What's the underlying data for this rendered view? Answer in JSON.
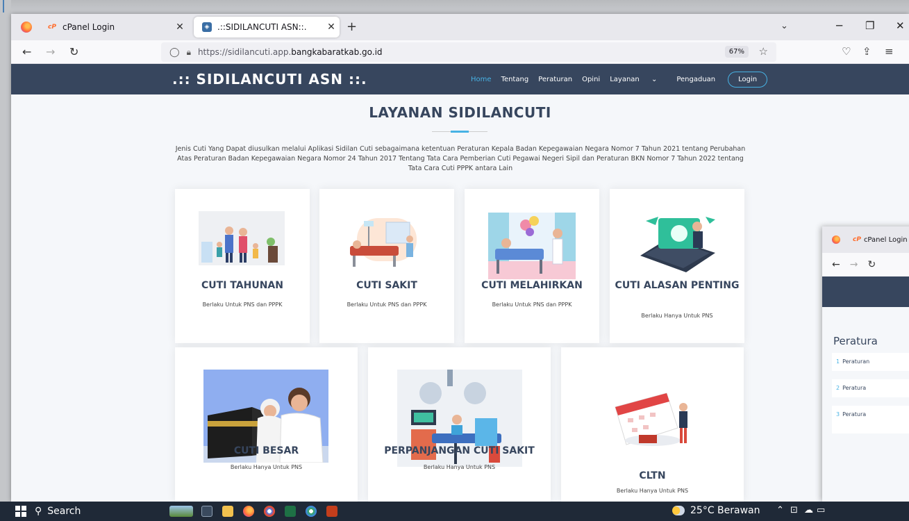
{
  "browser": {
    "tabs": [
      {
        "title": "cPanel Login",
        "favicon": "cpanel-icon"
      },
      {
        "title": ".::SIDILANCUTI ASN::.",
        "favicon": "site-icon",
        "active": true
      }
    ],
    "url_prefix": "https://sidilancuti.app.",
    "url_domain": "bangkabaratkab.go.id",
    "zoom": "67%"
  },
  "site": {
    "brand": ".:: SIDILANCUTI ASN ::.",
    "menu": [
      "Home",
      "Tentang",
      "Peraturan",
      "Opini",
      "Layanan",
      "Pengaduan"
    ],
    "login_label": "Login",
    "section_title": "LAYANAN SIDILANCUTI",
    "intro": "Jenis Cuti Yang Dapat diusulkan melalui Aplikasi Sidilan Cuti sebagaimana ketentuan Peraturan Kepala Badan Kepegawaian Negara Nomor 7 Tahun 2021 tentang Perubahan Atas Peraturan Badan Kepegawaian Negara Nomor 24 Tahun 2017 Tentang Tata Cara Pemberian Cuti Pegawai Negeri Sipil dan Peraturan BKN Nomor 7 Tahun 2022 tentang Tata Cara Cuti PPPK antara Lain",
    "services": [
      {
        "name": "CUTI TAHUNAN",
        "desc": "Berlaku Untuk PNS dan PPPK"
      },
      {
        "name": "CUTI SAKIT",
        "desc": "Berlaku Untuk PNS dan PPPK"
      },
      {
        "name": "CUTI MELAHIRKAN",
        "desc": "Berlaku Untuk PNS dan PPPK"
      },
      {
        "name": "CUTI ALASAN PENTING",
        "desc": "Berlaku Hanya Untuk PNS"
      },
      {
        "name": "CUTI BESAR",
        "desc": "Berlaku Hanya Untuk PNS"
      },
      {
        "name": "PERPANJANGAN CUTI SAKIT",
        "desc": "Berlaku Hanya Untuk PNS"
      },
      {
        "name": "CLTN",
        "desc": "Berlaku Hanya Untuk PNS"
      }
    ]
  },
  "second_window": {
    "tab_title": "cPanel Login",
    "heading": "Peratura",
    "items": [
      {
        "num": "1",
        "text": "Peraturan"
      },
      {
        "num": "2",
        "text": "Peratura"
      },
      {
        "num": "3",
        "text": "Peratura"
      }
    ]
  },
  "taskbar": {
    "search_label": "Search",
    "weather": "25°C Berawan"
  },
  "colors": {
    "header": "#37465e",
    "accent": "#47b2e4"
  }
}
